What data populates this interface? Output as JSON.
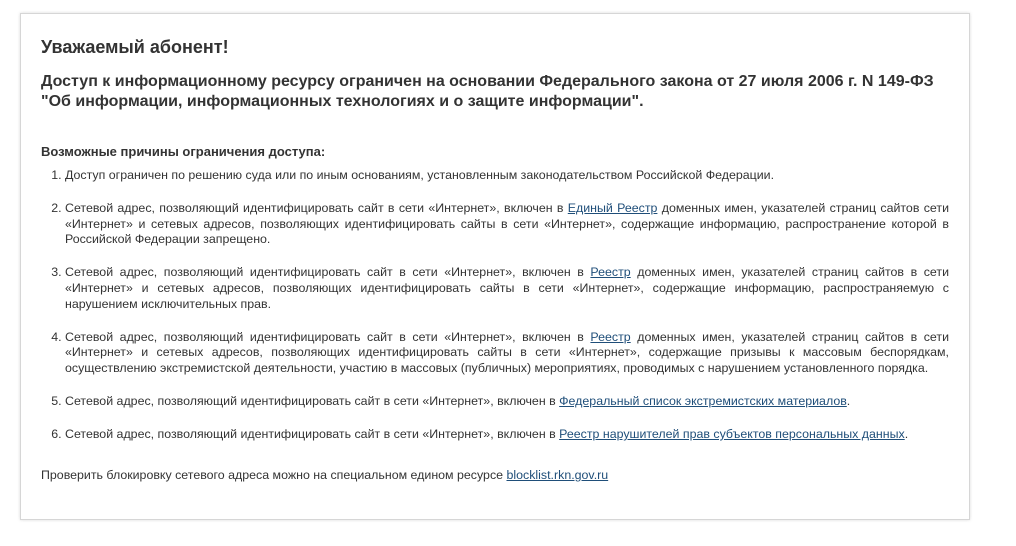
{
  "title": "Уважаемый абонент!",
  "subtitle": "Доступ к информационному ресурсу ограничен на основании Федерального закона от 27 июля 2006 г. N 149-ФЗ \"Об информации, информационных технологиях и о защите информации\".",
  "reasons_heading": "Возможные причины ограничения доступа:",
  "reasons": [
    {
      "before": "Доступ ограничен по решению суда или по иным основаниям, установленным законодательством Российской Федерации.",
      "link": "",
      "after": ""
    },
    {
      "before": "Сетевой адрес, позволяющий идентифицировать сайт в сети «Интернет», включен в ",
      "link": "Единый Реестр",
      "after": " доменных имен, указателей страниц сайтов сети «Интернет» и сетевых адресов, позволяющих идентифицировать сайты в сети «Интернет», содержащие информацию, распространение которой в Российской Федерации запрещено."
    },
    {
      "before": "Сетевой адрес, позволяющий идентифицировать сайт в сети «Интернет», включен в ",
      "link": "Реестр",
      "after": " доменных имен, указателей страниц сайтов в сети «Интернет» и сетевых адресов, позволяющих идентифицировать сайты в сети «Интернет», содержащие информацию, распространяемую с нарушением исключительных прав."
    },
    {
      "before": "Сетевой адрес, позволяющий идентифицировать сайт в сети «Интернет», включен в ",
      "link": "Реестр",
      "after": " доменных имен, указателей страниц сайтов в сети «Интернет» и сетевых адресов, позволяющих идентифицировать сайты в сети «Интернет», содержащие призывы к массовым беспорядкам, осуществлению экстремистской деятельности, участию в массовых (публичных) мероприятиях, проводимых с нарушением установленного порядка."
    },
    {
      "before": "Сетевой адрес, позволяющий идентифицировать сайт в сети «Интернет», включен в ",
      "link": "Федеральный список экстремистских материалов",
      "after": "."
    },
    {
      "before": "Сетевой адрес, позволяющий идентифицировать сайт в сети «Интернет», включен в ",
      "link": "Реестр нарушителей прав субъектов персональных данных",
      "after": "."
    }
  ],
  "footer": {
    "text": "Проверить блокировку сетевого адреса можно на специальном едином ресурсе ",
    "link": "blocklist.rkn.gov.ru"
  },
  "colors": {
    "text": "#333333",
    "link": "#1f4e79",
    "border": "#d6d6d6"
  }
}
